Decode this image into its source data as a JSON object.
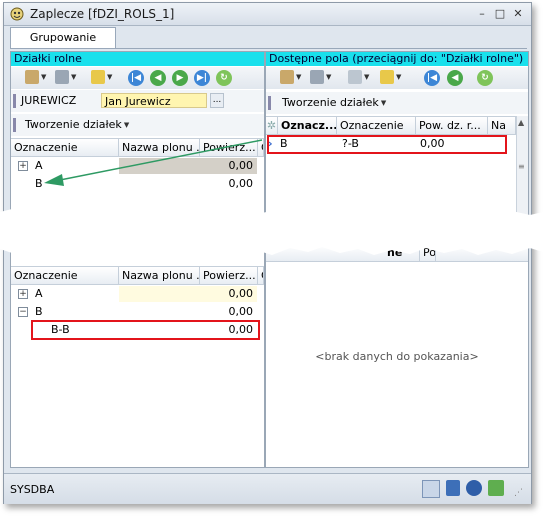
{
  "window": {
    "title": "Zaplecze [fDZI_ROLS_1]",
    "minimize": "–",
    "maximize": "□",
    "close": "✕"
  },
  "tabs": [
    {
      "label": "Grupowanie działek"
    }
  ],
  "left_panel": {
    "header": "Działki rolne",
    "owner_code": "JUREWICZ",
    "owner_name": "Jan Jurewicz",
    "ellipsis": "...",
    "group_button": "Tworzenie działek",
    "columns": [
      "Oznaczenie",
      "Nazwa plonu ...",
      "Powierz...",
      "C"
    ],
    "rows_before": [
      {
        "expander": "+",
        "name": "A",
        "area": "0,00"
      },
      {
        "expander": "",
        "name": "B",
        "area": "0,00"
      }
    ],
    "rows_after": [
      {
        "expander": "+",
        "name": "A",
        "area": "0,00"
      },
      {
        "expander": "−",
        "name": "B",
        "area": "0,00"
      },
      {
        "expander": "",
        "name": "B-B",
        "area": "0,00"
      }
    ]
  },
  "right_panel": {
    "header": "Dostępne pola (przeciągnij do: \"Działki rolne\")",
    "group_button": "Tworzenie działek",
    "columns": [
      "Oznacz...",
      "Oznaczenie",
      "Pow. dz. r...",
      "Na"
    ],
    "partial_column": "ne",
    "partial_column2": "Po",
    "row": {
      "indicator": "›",
      "col1": "B",
      "col2": "?-B",
      "col3": "0,00"
    },
    "empty_text": "<brak danych do pokazania>"
  },
  "status": {
    "user": "SYSDBA"
  },
  "colors": {
    "header_cyan": "#19e0ec",
    "highlight_red": "#e3141b",
    "owner_yellow": "#fff5b0",
    "arrow_green": "#2e9a63"
  }
}
